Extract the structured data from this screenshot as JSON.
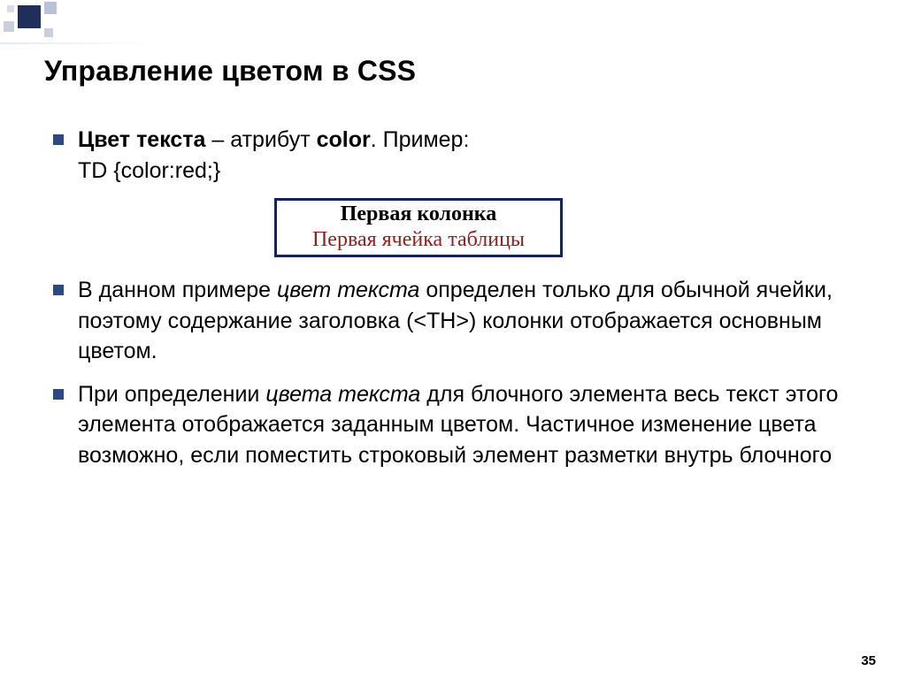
{
  "title": "Управление цветом в CSS",
  "bullets": {
    "b1_bold": "Цвет текста",
    "b1_dash": " – атрибут ",
    "b1_attr": "color",
    "b1_tail": ". Пример:",
    "b1_code": "TD {color:red;}",
    "b2_pre": "В данном примере ",
    "b2_ital": "цвет текста",
    "b2_post": " определен только для обычной ячейки, поэтому содержание заголовка (<TH>) колонки отображается основным цветом.",
    "b3_pre": "При определении ",
    "b3_ital": "цвета текста",
    "b3_post": " для блочного элемента весь текст этого элемента отображается заданным цветом. Частичное изменение цвета возможно, если поместить строковый элемент разметки внутрь блочного"
  },
  "example": {
    "th": "Первая колонка",
    "td": "Первая ячейка таблицы"
  },
  "page_number": "35"
}
